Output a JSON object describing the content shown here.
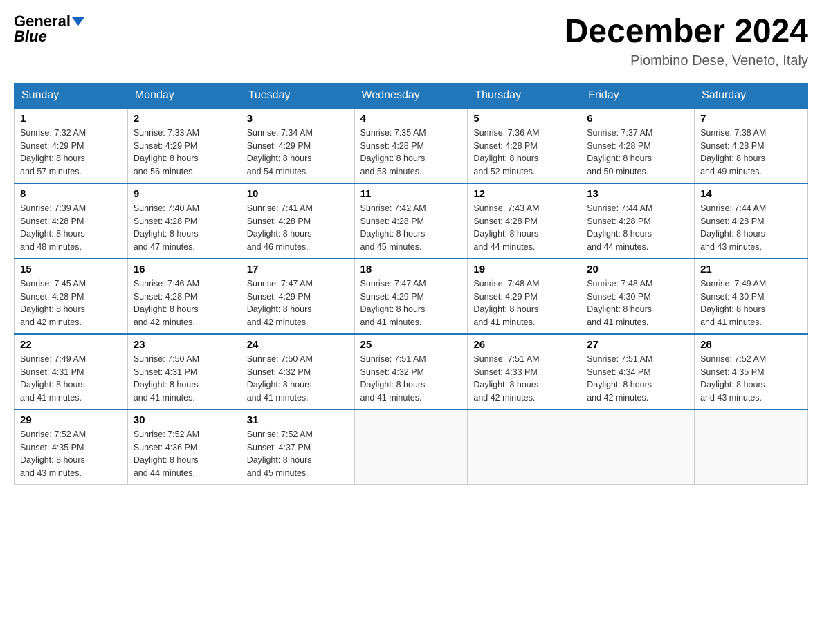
{
  "header": {
    "logo_text1": "General",
    "logo_text2": "Blue",
    "title": "December 2024",
    "subtitle": "Piombino Dese, Veneto, Italy"
  },
  "days_of_week": [
    "Sunday",
    "Monday",
    "Tuesday",
    "Wednesday",
    "Thursday",
    "Friday",
    "Saturday"
  ],
  "weeks": [
    [
      {
        "day": "1",
        "sunrise": "7:32 AM",
        "sunset": "4:29 PM",
        "daylight": "8 hours and 57 minutes."
      },
      {
        "day": "2",
        "sunrise": "7:33 AM",
        "sunset": "4:29 PM",
        "daylight": "8 hours and 56 minutes."
      },
      {
        "day": "3",
        "sunrise": "7:34 AM",
        "sunset": "4:29 PM",
        "daylight": "8 hours and 54 minutes."
      },
      {
        "day": "4",
        "sunrise": "7:35 AM",
        "sunset": "4:28 PM",
        "daylight": "8 hours and 53 minutes."
      },
      {
        "day": "5",
        "sunrise": "7:36 AM",
        "sunset": "4:28 PM",
        "daylight": "8 hours and 52 minutes."
      },
      {
        "day": "6",
        "sunrise": "7:37 AM",
        "sunset": "4:28 PM",
        "daylight": "8 hours and 50 minutes."
      },
      {
        "day": "7",
        "sunrise": "7:38 AM",
        "sunset": "4:28 PM",
        "daylight": "8 hours and 49 minutes."
      }
    ],
    [
      {
        "day": "8",
        "sunrise": "7:39 AM",
        "sunset": "4:28 PM",
        "daylight": "8 hours and 48 minutes."
      },
      {
        "day": "9",
        "sunrise": "7:40 AM",
        "sunset": "4:28 PM",
        "daylight": "8 hours and 47 minutes."
      },
      {
        "day": "10",
        "sunrise": "7:41 AM",
        "sunset": "4:28 PM",
        "daylight": "8 hours and 46 minutes."
      },
      {
        "day": "11",
        "sunrise": "7:42 AM",
        "sunset": "4:28 PM",
        "daylight": "8 hours and 45 minutes."
      },
      {
        "day": "12",
        "sunrise": "7:43 AM",
        "sunset": "4:28 PM",
        "daylight": "8 hours and 44 minutes."
      },
      {
        "day": "13",
        "sunrise": "7:44 AM",
        "sunset": "4:28 PM",
        "daylight": "8 hours and 44 minutes."
      },
      {
        "day": "14",
        "sunrise": "7:44 AM",
        "sunset": "4:28 PM",
        "daylight": "8 hours and 43 minutes."
      }
    ],
    [
      {
        "day": "15",
        "sunrise": "7:45 AM",
        "sunset": "4:28 PM",
        "daylight": "8 hours and 42 minutes."
      },
      {
        "day": "16",
        "sunrise": "7:46 AM",
        "sunset": "4:28 PM",
        "daylight": "8 hours and 42 minutes."
      },
      {
        "day": "17",
        "sunrise": "7:47 AM",
        "sunset": "4:29 PM",
        "daylight": "8 hours and 42 minutes."
      },
      {
        "day": "18",
        "sunrise": "7:47 AM",
        "sunset": "4:29 PM",
        "daylight": "8 hours and 41 minutes."
      },
      {
        "day": "19",
        "sunrise": "7:48 AM",
        "sunset": "4:29 PM",
        "daylight": "8 hours and 41 minutes."
      },
      {
        "day": "20",
        "sunrise": "7:48 AM",
        "sunset": "4:30 PM",
        "daylight": "8 hours and 41 minutes."
      },
      {
        "day": "21",
        "sunrise": "7:49 AM",
        "sunset": "4:30 PM",
        "daylight": "8 hours and 41 minutes."
      }
    ],
    [
      {
        "day": "22",
        "sunrise": "7:49 AM",
        "sunset": "4:31 PM",
        "daylight": "8 hours and 41 minutes."
      },
      {
        "day": "23",
        "sunrise": "7:50 AM",
        "sunset": "4:31 PM",
        "daylight": "8 hours and 41 minutes."
      },
      {
        "day": "24",
        "sunrise": "7:50 AM",
        "sunset": "4:32 PM",
        "daylight": "8 hours and 41 minutes."
      },
      {
        "day": "25",
        "sunrise": "7:51 AM",
        "sunset": "4:32 PM",
        "daylight": "8 hours and 41 minutes."
      },
      {
        "day": "26",
        "sunrise": "7:51 AM",
        "sunset": "4:33 PM",
        "daylight": "8 hours and 42 minutes."
      },
      {
        "day": "27",
        "sunrise": "7:51 AM",
        "sunset": "4:34 PM",
        "daylight": "8 hours and 42 minutes."
      },
      {
        "day": "28",
        "sunrise": "7:52 AM",
        "sunset": "4:35 PM",
        "daylight": "8 hours and 43 minutes."
      }
    ],
    [
      {
        "day": "29",
        "sunrise": "7:52 AM",
        "sunset": "4:35 PM",
        "daylight": "8 hours and 43 minutes."
      },
      {
        "day": "30",
        "sunrise": "7:52 AM",
        "sunset": "4:36 PM",
        "daylight": "8 hours and 44 minutes."
      },
      {
        "day": "31",
        "sunrise": "7:52 AM",
        "sunset": "4:37 PM",
        "daylight": "8 hours and 45 minutes."
      },
      null,
      null,
      null,
      null
    ]
  ],
  "labels": {
    "sunrise": "Sunrise:",
    "sunset": "Sunset:",
    "daylight": "Daylight:"
  }
}
